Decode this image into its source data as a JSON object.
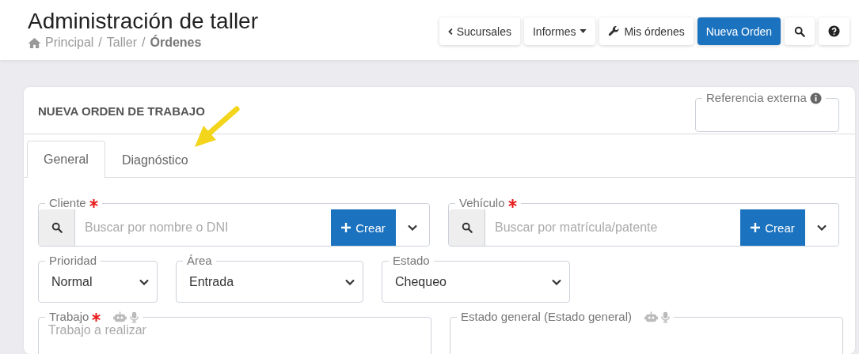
{
  "header": {
    "title": "Administración de taller",
    "breadcrumb": [
      {
        "label": "Principal",
        "home_icon": true,
        "current": false
      },
      {
        "separator": "/",
        "label": "Taller",
        "current": false
      },
      {
        "separator": "/",
        "label": "Órdenes",
        "current": true
      }
    ],
    "buttons": [
      {
        "kind": "back",
        "label": "Sucursales"
      },
      {
        "kind": "dropdown",
        "label": "Informes"
      },
      {
        "kind": "tool",
        "label": "Mis órdenes"
      },
      {
        "kind": "primary",
        "label": "Nueva Orden"
      },
      {
        "kind": "search"
      },
      {
        "kind": "help"
      }
    ]
  },
  "card": {
    "title": "NUEVA ORDEN DE TRABAJO",
    "external_reference": {
      "label": "Referencia externa",
      "info": true
    },
    "tabs": [
      {
        "label": "General",
        "selected": true
      },
      {
        "label": "Diagnóstico",
        "selected": false
      }
    ],
    "rows": [
      [
        {
          "kind": "search",
          "label": "Cliente",
          "required": true,
          "placeholder": "Buscar por nombre o DNI",
          "create_label": "Crear"
        },
        {
          "kind": "search",
          "label": "Vehículo",
          "required": true,
          "placeholder": "Buscar por matrícula/patente",
          "create_label": "Crear"
        }
      ],
      [
        {
          "kind": "select",
          "label": "Prioridad",
          "value": "Normal"
        },
        {
          "kind": "select",
          "label": "Área",
          "value": "Entrada"
        },
        {
          "kind": "select",
          "label": "Estado",
          "value": "Chequeo"
        }
      ],
      [
        {
          "kind": "textarea",
          "label": "Trabajo",
          "required": true,
          "assist_icons": true,
          "placeholder": "Trabajo a realizar"
        },
        {
          "kind": "textarea",
          "label": "Estado general (Estado general)",
          "required": false,
          "assist_icons": true
        }
      ]
    ]
  }
}
